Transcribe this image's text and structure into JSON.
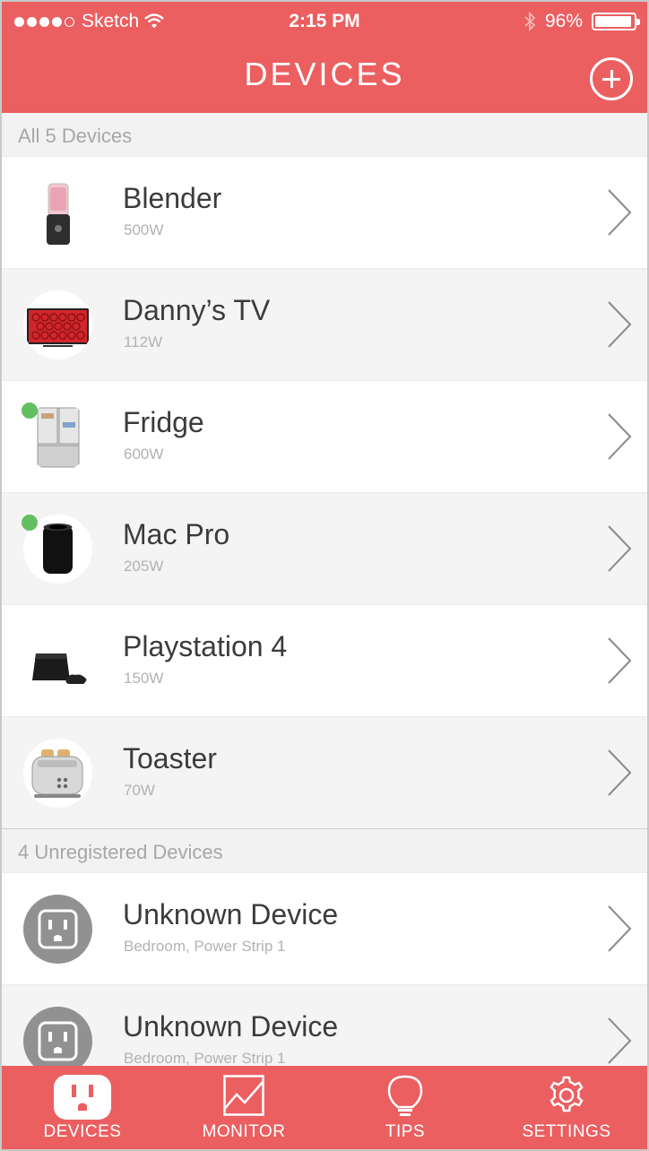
{
  "status_bar": {
    "carrier": "Sketch",
    "time": "2:15 PM",
    "battery": "96%",
    "battery_level": 0.96
  },
  "header": {
    "title": "DEVICES",
    "add_icon": "plus-circle-icon"
  },
  "registered": {
    "header": "All 5 Devices",
    "items": [
      {
        "name": "Blender",
        "watts": "500W",
        "online": false,
        "icon": "blender-image"
      },
      {
        "name": "Danny’s TV",
        "watts": "112W",
        "online": false,
        "icon": "tv-image"
      },
      {
        "name": "Fridge",
        "watts": "600W",
        "online": true,
        "icon": "fridge-image"
      },
      {
        "name": "Mac Pro",
        "watts": "205W",
        "online": true,
        "icon": "mac-pro-image"
      },
      {
        "name": "Playstation 4",
        "watts": "150W",
        "online": false,
        "icon": "playstation-image"
      },
      {
        "name": "Toaster",
        "watts": "70W",
        "online": false,
        "icon": "toaster-image"
      }
    ]
  },
  "unregistered": {
    "header": "4 Unregistered Devices",
    "items": [
      {
        "name": "Unknown Device",
        "location": "Bedroom, Power Strip 1",
        "icon": "outlet-icon"
      },
      {
        "name": "Unknown Device",
        "location": "Bedroom, Power Strip 1",
        "icon": "outlet-icon"
      }
    ]
  },
  "tabs": [
    {
      "label": "DEVICES",
      "icon": "outlet-icon",
      "active": true
    },
    {
      "label": "MONITOR",
      "icon": "chart-icon",
      "active": false
    },
    {
      "label": "TIPS",
      "icon": "lightbulb-icon",
      "active": false
    },
    {
      "label": "SETTINGS",
      "icon": "gear-icon",
      "active": false
    }
  ],
  "colors": {
    "brand": "#eb5f61",
    "online": "#63c062",
    "row_alt": "#f4f4f4"
  }
}
